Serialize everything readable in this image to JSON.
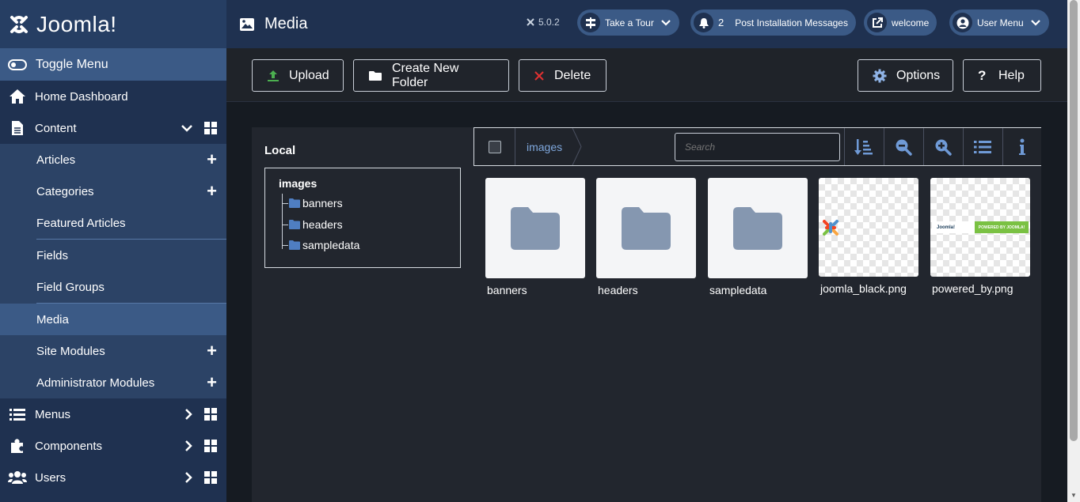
{
  "sidebar": {
    "logo_text": "Joomla!",
    "toggle_label": "Toggle Menu",
    "home": "Home Dashboard",
    "content": "Content",
    "content_items": [
      {
        "label": "Articles"
      },
      {
        "label": "Categories"
      },
      {
        "label": "Featured Articles"
      },
      {
        "label": "Fields"
      },
      {
        "label": "Field Groups"
      },
      {
        "label": "Media"
      },
      {
        "label": "Site Modules"
      },
      {
        "label": "Administrator Modules"
      }
    ],
    "menus": "Menus",
    "components": "Components",
    "users": "Users"
  },
  "header": {
    "title": "Media",
    "version": "5.0.2",
    "tour_label": "Take a Tour",
    "notification_count": "2",
    "post_install_label": "Post Installation Messages",
    "welcome_label": "welcome",
    "user_menu_label": "User Menu"
  },
  "toolbar": {
    "upload": "Upload",
    "create_folder": "Create New Folder",
    "delete": "Delete",
    "options": "Options",
    "help": "Help"
  },
  "browser": {
    "local_title": "Local",
    "tree_root": "images",
    "tree_children": [
      "banners",
      "headers",
      "sampledata"
    ],
    "breadcrumb": "images",
    "search_placeholder": "Search",
    "items": [
      {
        "name": "banners",
        "type": "folder"
      },
      {
        "name": "headers",
        "type": "folder"
      },
      {
        "name": "sampledata",
        "type": "folder"
      },
      {
        "name": "joomla_black.png",
        "type": "image"
      },
      {
        "name": "powered_by.png",
        "type": "image"
      }
    ],
    "powered_badge": "POWERED BY JOOMLA!",
    "powered_logo_text": "Joomla!"
  },
  "colors": {
    "sidebar_bg": "#1f3150",
    "active_bg": "#3b5a86",
    "folder_icon": "#8597b0",
    "breadcrumb_link": "#7fa8dd"
  }
}
